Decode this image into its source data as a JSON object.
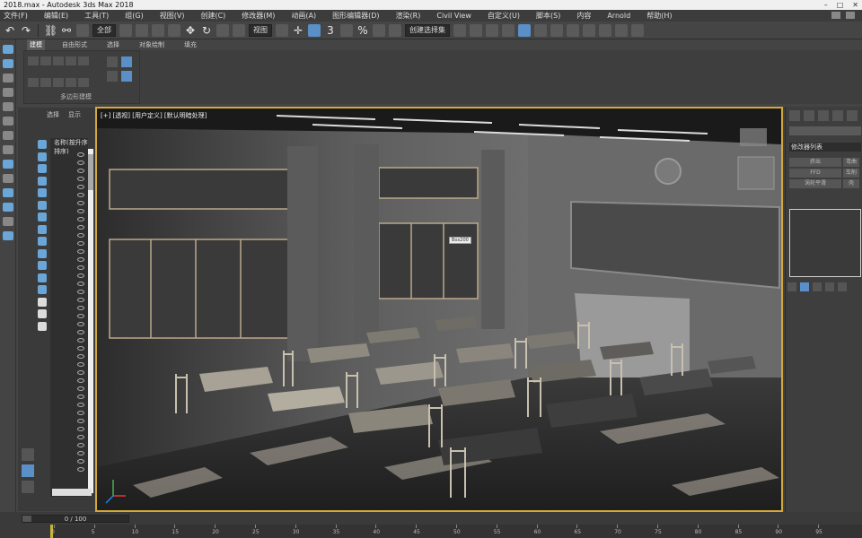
{
  "window": {
    "title": "2018.max - Autodesk 3ds Max 2018"
  },
  "menu": [
    "文件(F)",
    "编辑(E)",
    "工具(T)",
    "组(G)",
    "视图(V)",
    "创建(C)",
    "修改器(M)",
    "动画(A)",
    "图形编辑器(D)",
    "渲染(R)",
    "Civil View",
    "自定义(U)",
    "脚本(S)",
    "内容",
    "Arnold",
    "帮助(H)"
  ],
  "toolbar": {
    "selection_filter": "全部",
    "ref_coord": "视图",
    "named_selection": "创建选择集"
  },
  "ribbon": {
    "tabs": [
      "建模",
      "自由形式",
      "选择",
      "对象绘制",
      "填充"
    ],
    "active_tab": "建模",
    "panel_label": "多边形建模"
  },
  "scene_explorer": {
    "tabs": [
      "选择",
      "显示"
    ],
    "root_item": "名称(按升序排序)"
  },
  "viewport": {
    "label": "[+] [透视] [用户定义] [默认明暗处理]",
    "object_tag": "Box200"
  },
  "command_panel": {
    "modifier_list_label": "修改器列表",
    "buttons": [
      "挤出",
      "弯曲",
      "FFD",
      "车削",
      "涡轮平滑",
      "壳"
    ]
  },
  "timeline": {
    "frame_display": "0 / 100",
    "ticks": [
      0,
      5,
      10,
      15,
      20,
      25,
      30,
      35,
      40,
      45,
      50,
      55,
      60,
      65,
      70,
      75,
      80,
      85,
      90,
      95
    ]
  }
}
